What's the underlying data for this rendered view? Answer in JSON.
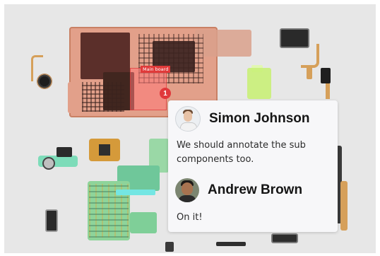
{
  "annotation": {
    "region_label": "Main board",
    "badge_number": "1",
    "region_color": "#e03a3a"
  },
  "thread": {
    "comments": [
      {
        "author": "Simon Johnson",
        "avatar_icon": "person-avatar-icon",
        "text": "We should annotate the sub components too."
      },
      {
        "author": "Andrew Brown",
        "avatar_icon": "person-avatar-icon",
        "text": "On it!"
      }
    ]
  }
}
